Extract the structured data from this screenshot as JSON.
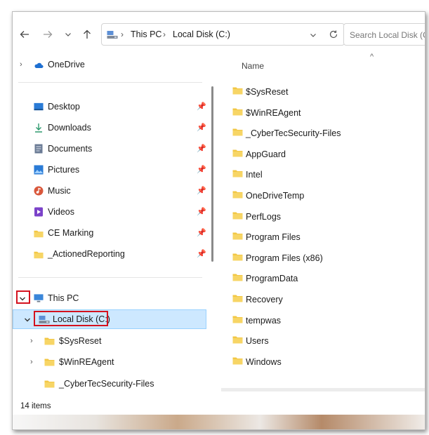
{
  "address": {
    "crumb_1": "This PC",
    "crumb_2": "Local Disk (C:)"
  },
  "search": {
    "placeholder": "Search Local Disk (C:)"
  },
  "nav_pane": {
    "onedrive": "OneDrive",
    "quick_access": [
      {
        "label": "Desktop",
        "icon": "desktop-icon",
        "color": "#2a7bd6"
      },
      {
        "label": "Downloads",
        "icon": "download-icon",
        "color": "#2e9a6e"
      },
      {
        "label": "Documents",
        "icon": "document-icon",
        "color": "#6b7b95"
      },
      {
        "label": "Pictures",
        "icon": "pictures-icon",
        "color": "#2a7bd6"
      },
      {
        "label": "Music",
        "icon": "music-icon",
        "color": "#d9573b"
      },
      {
        "label": "Videos",
        "icon": "videos-icon",
        "color": "#7b42c9"
      },
      {
        "label": "CE Marking",
        "icon": "folder-icon",
        "color": "#f2c744"
      },
      {
        "label": "_ActionedReporting",
        "icon": "folder-icon",
        "color": "#f2c744"
      }
    ],
    "this_pc": "This PC",
    "local_disk": "Local Disk (C:)",
    "subfolders": [
      "$SysReset",
      "$WinREAgent",
      "_CyberTecSecurity-Files"
    ]
  },
  "file_list": {
    "column_name": "Name",
    "items": [
      "$SysReset",
      "$WinREAgent",
      "_CyberTecSecurity-Files",
      "AppGuard",
      "Intel",
      "OneDriveTemp",
      "PerfLogs",
      "Program Files",
      "Program Files (x86)",
      "ProgramData",
      "Recovery",
      "tempwas",
      "Users",
      "Windows"
    ]
  },
  "status": {
    "count": "14 items"
  },
  "colors": {
    "folder": "#f2c744",
    "selection": "#cde8ff",
    "highlight_box": "#d4121e"
  }
}
